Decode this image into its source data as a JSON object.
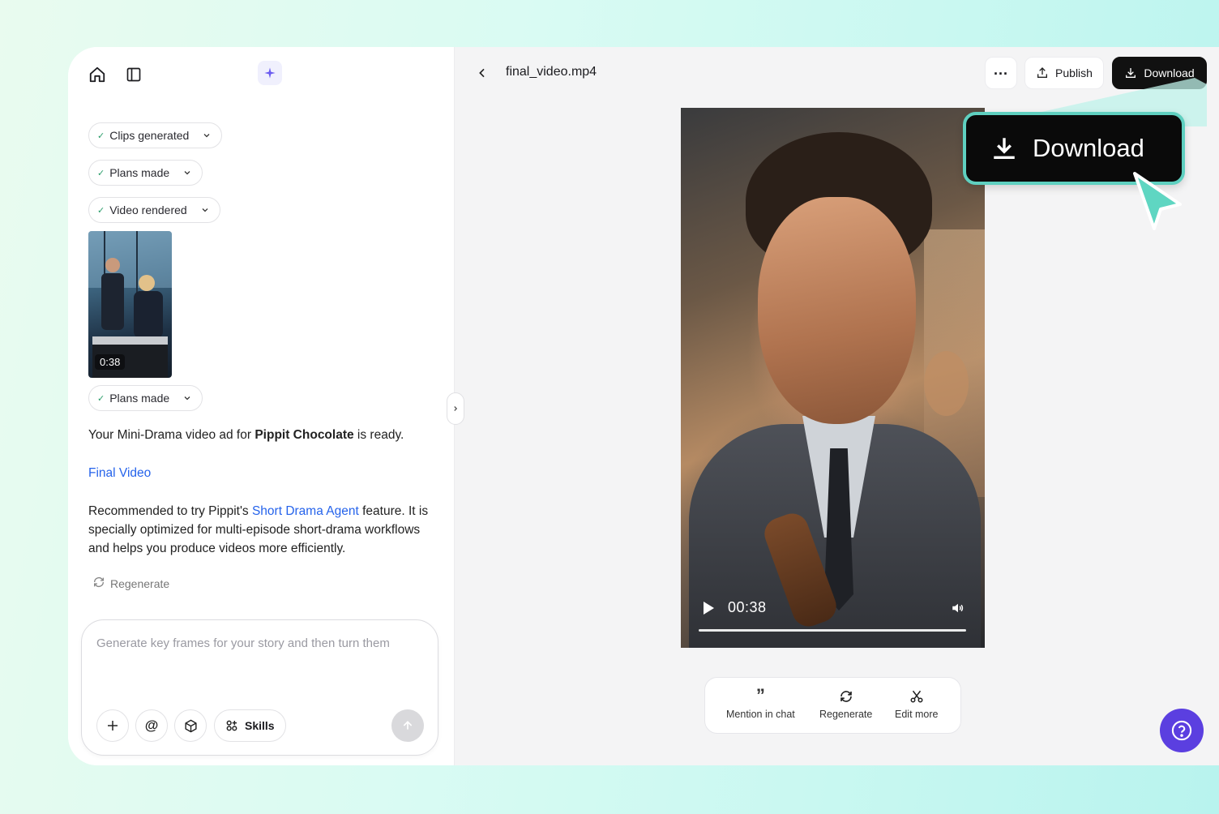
{
  "sidebar": {
    "status_chips": [
      {
        "label": "Clips generated"
      },
      {
        "label": "Plans made"
      },
      {
        "label": "Video rendered"
      },
      {
        "label": "Plans made"
      }
    ],
    "thumbnail_duration": "0:38",
    "message": {
      "ready_prefix": "Your Mini-Drama video ad for ",
      "brand": "Pippit Chocolate",
      "ready_suffix": " is ready.",
      "final_video_link": "Final Video",
      "rec_prefix": "Recommended to try Pippit's ",
      "rec_link": "Short Drama Agent",
      "rec_suffix": " feature. It is specially optimized for multi-episode short-drama workflows and helps you produce videos more efficiently."
    },
    "regenerate_label": "Regenerate",
    "composer": {
      "placeholder": "Generate key frames for your story and then turn them",
      "skills_label": "Skills"
    }
  },
  "viewer": {
    "file_name": "final_video.mp4",
    "publish_label": "Publish",
    "download_label": "Download",
    "video_time": "00:38",
    "actions": [
      {
        "label": "Mention in chat",
        "icon": "quote-icon"
      },
      {
        "label": "Regenerate",
        "icon": "refresh-icon"
      },
      {
        "label": "Edit more",
        "icon": "scissors-icon"
      }
    ]
  },
  "callout": {
    "label": "Download"
  },
  "colors": {
    "accent": "#5b3fe0",
    "link": "#2563eb",
    "callout_border": "#5fd0c0"
  }
}
